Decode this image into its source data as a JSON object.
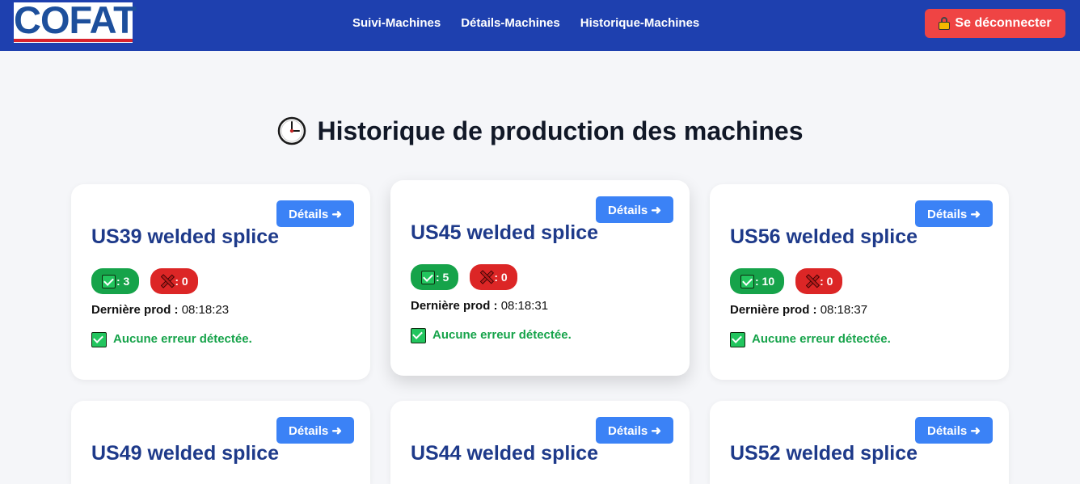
{
  "header": {
    "logo_text": "COFAT",
    "nav": [
      "Suivi-Machines",
      "Détails-Machines",
      "Historique-Machines"
    ],
    "logout_label": "Se déconnecter"
  },
  "page": {
    "title": "Historique de production des machines"
  },
  "cards": [
    {
      "name": "US39 welded splice",
      "ok": ": 3",
      "ko": ": 0",
      "last_prod_label": "Dernière prod :",
      "last_prod_time": "08:18:23",
      "status": "Aucune erreur détectée.",
      "details": "Détails ➜"
    },
    {
      "name": "US45 welded splice",
      "ok": ": 5",
      "ko": ": 0",
      "last_prod_label": "Dernière prod :",
      "last_prod_time": "08:18:31",
      "status": "Aucune erreur détectée.",
      "details": "Détails ➜"
    },
    {
      "name": "US56 welded splice",
      "ok": ": 10",
      "ko": ": 0",
      "last_prod_label": "Dernière prod :",
      "last_prod_time": "08:18:37",
      "status": "Aucune erreur détectée.",
      "details": "Détails ➜"
    },
    {
      "name": "US49 welded splice",
      "details": "Détails ➜"
    },
    {
      "name": "US44 welded splice",
      "details": "Détails ➜"
    },
    {
      "name": "US52 welded splice",
      "details": "Détails ➜"
    }
  ],
  "colors": {
    "navbar": "#1e40af",
    "logout": "#ef4444",
    "details_button": "#3b82f6",
    "ok_badge": "#16a34a",
    "ko_badge": "#dc2626",
    "card_title": "#1e3a8a"
  }
}
